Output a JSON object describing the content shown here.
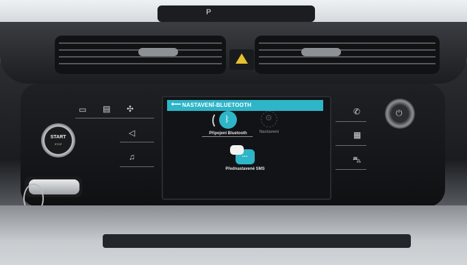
{
  "screen": {
    "title": "NASTAVENÍ-BLUETOOTH",
    "back_icon": "back-arrow-icon",
    "accent_color": "#2fb5c8",
    "items": [
      {
        "label": "Připojení Bluetooth",
        "icon": "bluetooth-icon",
        "state": "active"
      },
      {
        "label": "Nastavení",
        "icon": "settings-gear-icon",
        "state": "dimmed"
      },
      {
        "label": "Přednastavené SMS",
        "icon": "sms-icon",
        "state": "active"
      }
    ]
  },
  "physical": {
    "start_button": {
      "label": "START",
      "sublabel": "STOP"
    },
    "left_controls": [
      "rear-defrost-icon",
      "front-defrost-icon",
      "fan-icon",
      "volume-icon",
      "music-icon"
    ],
    "right_controls": [
      "phone-icon",
      "apps-icon",
      "car-icon"
    ],
    "power_knob_icon": "power-icon"
  }
}
